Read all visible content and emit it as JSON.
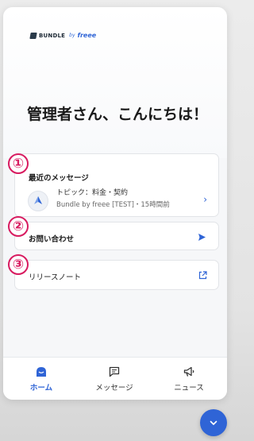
{
  "brand": {
    "name": "BUNDLE",
    "by": "by",
    "partner": "freee"
  },
  "greeting": "管理者さん、こんにちは！",
  "markers": [
    "①",
    "②",
    "③"
  ],
  "recent_messages": {
    "title": "最近のメッセージ",
    "items": [
      {
        "topic": "トピック：料金・契約",
        "meta": "Bundle by freee [TEST]・15時間前"
      }
    ]
  },
  "contact": {
    "label": "お問い合わせ"
  },
  "release_notes": {
    "label": "リリースノート"
  },
  "tabs": [
    {
      "label": "ホーム",
      "icon": "home-icon",
      "active": true
    },
    {
      "label": "メッセージ",
      "icon": "message-icon",
      "active": false
    },
    {
      "label": "ニュース",
      "icon": "megaphone-icon",
      "active": false
    }
  ],
  "colors": {
    "accent": "#2f64d6",
    "marker": "#d81b60"
  }
}
